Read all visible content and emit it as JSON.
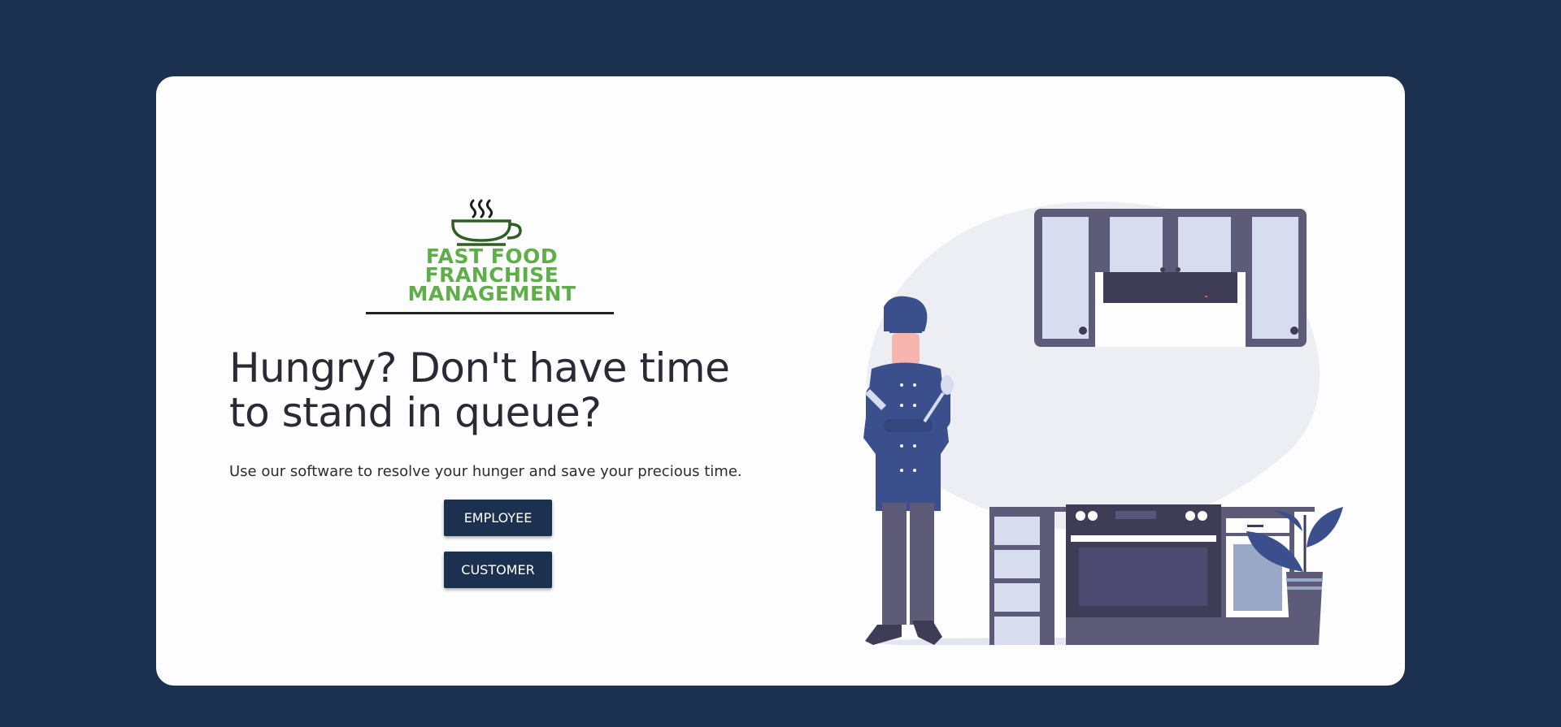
{
  "logo": {
    "lines": [
      "FAST FOOD",
      "FRANCHISE",
      "MANAGEMENT"
    ],
    "icon": "steaming-cup-icon",
    "color": "#5fae4a"
  },
  "hero": {
    "headline": "Hungry? Don't have time to stand in queue?",
    "subtext": "Use our software to resolve your hunger and save your precious time."
  },
  "buttons": {
    "employee": "EMPLOYEE",
    "customer": "CUSTOMER"
  },
  "illustration": {
    "icon": "chef-kitchen-illustration"
  },
  "colors": {
    "background": "#1c3150",
    "card": "#fdfdfe",
    "button": "#1c3150",
    "accent_blue": "#3a4f8c"
  }
}
